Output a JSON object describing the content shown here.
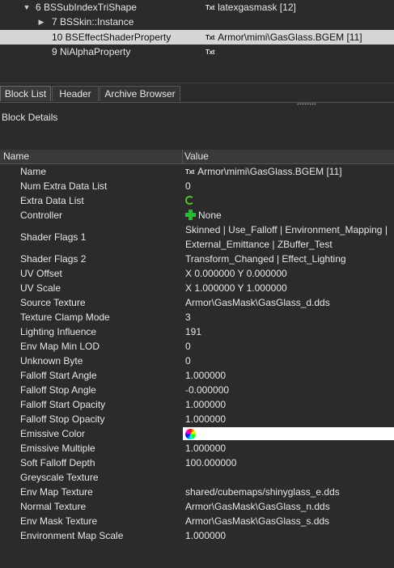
{
  "tree": {
    "rows": [
      {
        "name": "6 BSSubIndexTriShape",
        "value": "latexgasmask [12]",
        "arrow": "▼"
      },
      {
        "name": "7 BSSkin::Instance",
        "value": "",
        "arrow": "▶"
      },
      {
        "name": "10 BSEffectShaderProperty",
        "value": "Armor\\mimi\\GasGlass.BGEM [11]",
        "arrow": ""
      },
      {
        "name": "9 NiAlphaProperty",
        "value": "",
        "arrow": ""
      }
    ],
    "txt_icon": "Txt"
  },
  "tabs": [
    {
      "label": "Block List"
    },
    {
      "label": "Header"
    },
    {
      "label": "Archive Browser"
    }
  ],
  "block_details": {
    "title": "Block Details",
    "columns": {
      "name": "Name",
      "value": "Value"
    },
    "rows": [
      {
        "name": "Name",
        "value": "Armor\\mimi\\GasGlass.BGEM [11]"
      },
      {
        "name": "Num Extra Data List",
        "value": "0"
      },
      {
        "name": "Extra Data List",
        "value": ""
      },
      {
        "name": "Controller",
        "value": "None"
      },
      {
        "name": "Shader Flags 1",
        "value": "Skinned | Use_Falloff | Environment_Mapping | External_Emittance | ZBuffer_Test"
      },
      {
        "name": "Shader Flags 2",
        "value": "Transform_Changed | Effect_Lighting"
      },
      {
        "name": "UV Offset",
        "value": "X 0.000000 Y 0.000000"
      },
      {
        "name": "UV Scale",
        "value": "X 1.000000 Y 1.000000"
      },
      {
        "name": "Source Texture",
        "value": "Armor\\GasMask\\GasGlass_d.dds"
      },
      {
        "name": "Texture Clamp Mode",
        "value": "3"
      },
      {
        "name": "Lighting Influence",
        "value": "191"
      },
      {
        "name": "Env Map Min LOD",
        "value": "0"
      },
      {
        "name": "Unknown Byte",
        "value": "0"
      },
      {
        "name": "Falloff Start Angle",
        "value": "1.000000"
      },
      {
        "name": "Falloff Stop Angle",
        "value": "-0.000000"
      },
      {
        "name": "Falloff Start Opacity",
        "value": "1.000000"
      },
      {
        "name": "Falloff Stop Opacity",
        "value": "1.000000"
      },
      {
        "name": "Emissive Color",
        "value": ""
      },
      {
        "name": "Emissive Multiple",
        "value": "1.000000"
      },
      {
        "name": "Soft Falloff Depth",
        "value": "100.000000"
      },
      {
        "name": "Greyscale Texture",
        "value": ""
      },
      {
        "name": "Env Map Texture",
        "value": "shared/cubemaps/shinyglass_e.dds"
      },
      {
        "name": "Normal Texture",
        "value": "Armor\\GasMask\\GasGlass_n.dds"
      },
      {
        "name": "Env Mask Texture",
        "value": "Armor\\GasMask\\GasGlass_s.dds"
      },
      {
        "name": "Environment Map Scale",
        "value": "1.000000"
      }
    ],
    "emissive_color_hex": "#ffffff"
  }
}
